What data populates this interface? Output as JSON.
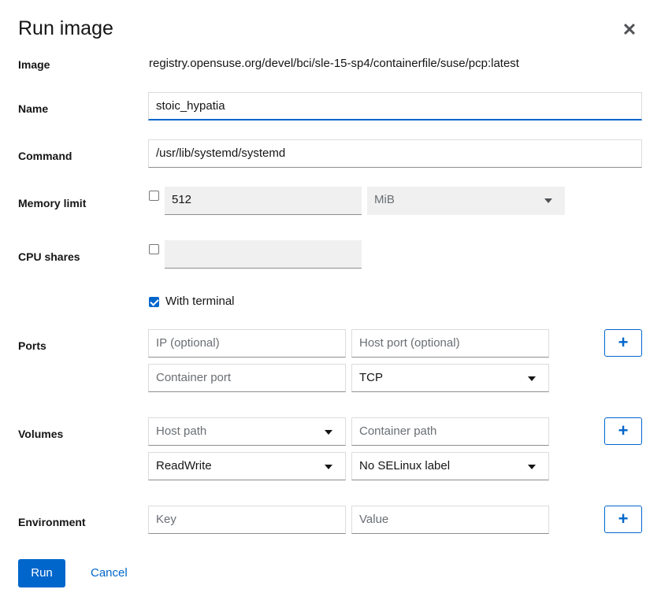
{
  "dialog": {
    "title": "Run image",
    "close_glyph": "✕"
  },
  "image": {
    "label": "Image",
    "value": "registry.opensuse.org/devel/bci/sle-15-sp4/containerfile/suse/pcp:latest"
  },
  "name": {
    "label": "Name",
    "value": "stoic_hypatia"
  },
  "command": {
    "label": "Command",
    "value": "/usr/lib/systemd/systemd"
  },
  "memory": {
    "label": "Memory limit",
    "checked": false,
    "value": "512",
    "unit": "MiB"
  },
  "cpu": {
    "label": "CPU shares",
    "checked": false,
    "value": ""
  },
  "terminal": {
    "label": "With terminal",
    "checked": true
  },
  "ports": {
    "label": "Ports",
    "ip_placeholder": "IP (optional)",
    "host_port_placeholder": "Host port (optional)",
    "container_port_placeholder": "Container port",
    "protocol": "TCP",
    "add_glyph": "+"
  },
  "volumes": {
    "label": "Volumes",
    "host_path_placeholder": "Host path",
    "container_path_placeholder": "Container path",
    "mode": "ReadWrite",
    "selinux": "No SELinux label",
    "add_glyph": "+"
  },
  "environment": {
    "label": "Environment",
    "key_placeholder": "Key",
    "value_placeholder": "Value",
    "add_glyph": "+"
  },
  "footer": {
    "run_label": "Run",
    "cancel_label": "Cancel"
  },
  "colors": {
    "accent": "#0066cc",
    "text": "#151515",
    "placeholder": "#6a6e73",
    "disabled_bg": "#f0f0f0"
  }
}
